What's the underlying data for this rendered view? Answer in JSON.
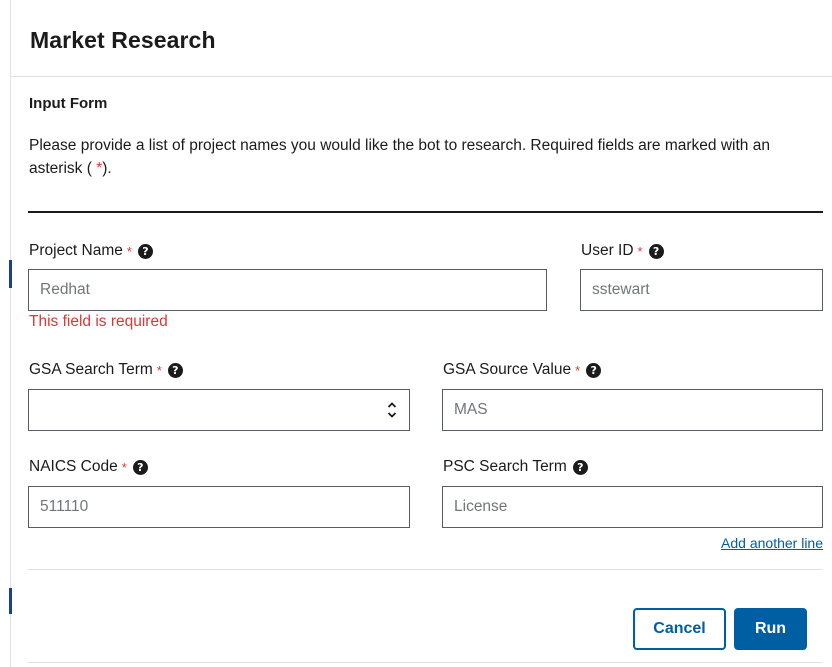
{
  "modal": {
    "title": "Market Research",
    "section_title": "Input Form",
    "instructions": "Please provide a list of project names you would like the bot to research. Required fields are marked with an asterisk (",
    "instructions_star": "*",
    "instructions_end": ")."
  },
  "fields": {
    "required_mark": "*",
    "help_glyph": "?",
    "project_name": {
      "label": "Project Name",
      "value": "Redhat",
      "error": "This field is required"
    },
    "user_id": {
      "label": "User ID",
      "value": "sstewart"
    },
    "gsa_search_term": {
      "label": "GSA Search Term",
      "value": ""
    },
    "gsa_source_value": {
      "label": "GSA Source Value",
      "value": "MAS"
    },
    "naics_code": {
      "label": "NAICS Code",
      "value": "511110"
    },
    "psc_search_term": {
      "label": "PSC Search Term",
      "value": "License"
    }
  },
  "actions": {
    "add_line": "Add another line",
    "cancel": "Cancel",
    "run": "Run"
  },
  "colors": {
    "primary": "#005ea2",
    "error": "#d83933",
    "border": "#565c65",
    "text": "#1b1b1b"
  }
}
